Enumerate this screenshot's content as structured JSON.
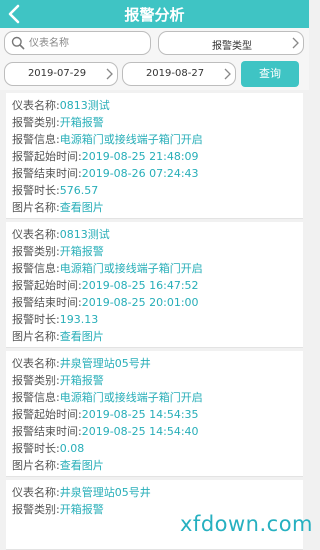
{
  "header": {
    "title": "报警分析"
  },
  "filters": {
    "search_placeholder": "仪表名称",
    "alarm_type": "报警类型",
    "start_date": "2019-07-29",
    "end_date": "2019-08-27",
    "query_label": "查询"
  },
  "field_labels": {
    "meter_name": "仪表名称:",
    "alarm_category": "报警类别:",
    "alarm_info": "报警信息:",
    "start_time": "报警起始时间:",
    "end_time": "报警结束时间:",
    "duration": "报警时长:",
    "image_name": "图片名称:"
  },
  "records": [
    {
      "meter_name": "0813测试",
      "category": "开箱报警",
      "info": "电源箱门或接线端子箱门开启",
      "start_time": "2019-08-25 21:48:09",
      "end_time": "2019-08-26 07:24:43",
      "duration": "576.57",
      "image": "查看图片"
    },
    {
      "meter_name": "0813测试",
      "category": "开箱报警",
      "info": "电源箱门或接线端子箱门开启",
      "start_time": "2019-08-25 16:47:52",
      "end_time": "2019-08-25 20:01:00",
      "duration": "193.13",
      "image": "查看图片"
    },
    {
      "meter_name": "井泉管理站05号井",
      "category": "开箱报警",
      "info": "电源箱门或接线端子箱门开启",
      "start_time": "2019-08-25 14:54:35",
      "end_time": "2019-08-25 14:54:40",
      "duration": "0.08",
      "image": "查看图片"
    },
    {
      "meter_name": "井泉管理站05号井",
      "category": "开箱报警"
    }
  ],
  "watermark": "xfdown.com"
}
